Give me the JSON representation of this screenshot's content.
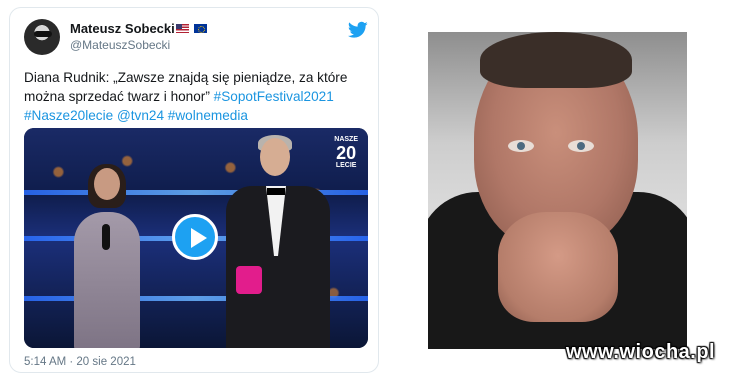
{
  "tweet": {
    "author_name": "Mateusz Sobecki",
    "handle": "@MateuszSobecki",
    "text_plain": "Diana Rudnik: „Zawsze znajdą się pieniądze, za które można sprzedać twarz i honor”",
    "hashtags": [
      "#SopotFestival2021",
      "#Nasze20lecie"
    ],
    "mentions": [
      "@tvn24"
    ],
    "hashtag_last": "#wolnemedia",
    "timestamp": "5:14 AM · 20 sie 2021",
    "video_logo_top": "NASZE",
    "video_logo_num": "20",
    "video_logo_bottom": "LECIE"
  },
  "watermark": "www.wiocha.pl",
  "colors": {
    "link": "#1b95e0",
    "twitter_blue": "#1da1f2",
    "text": "#14171a",
    "muted": "#657786"
  },
  "icons": {
    "twitter": "twitter-bird-icon",
    "play": "play-icon",
    "flags": [
      "us-flag-icon",
      "eu-flag-icon"
    ]
  }
}
